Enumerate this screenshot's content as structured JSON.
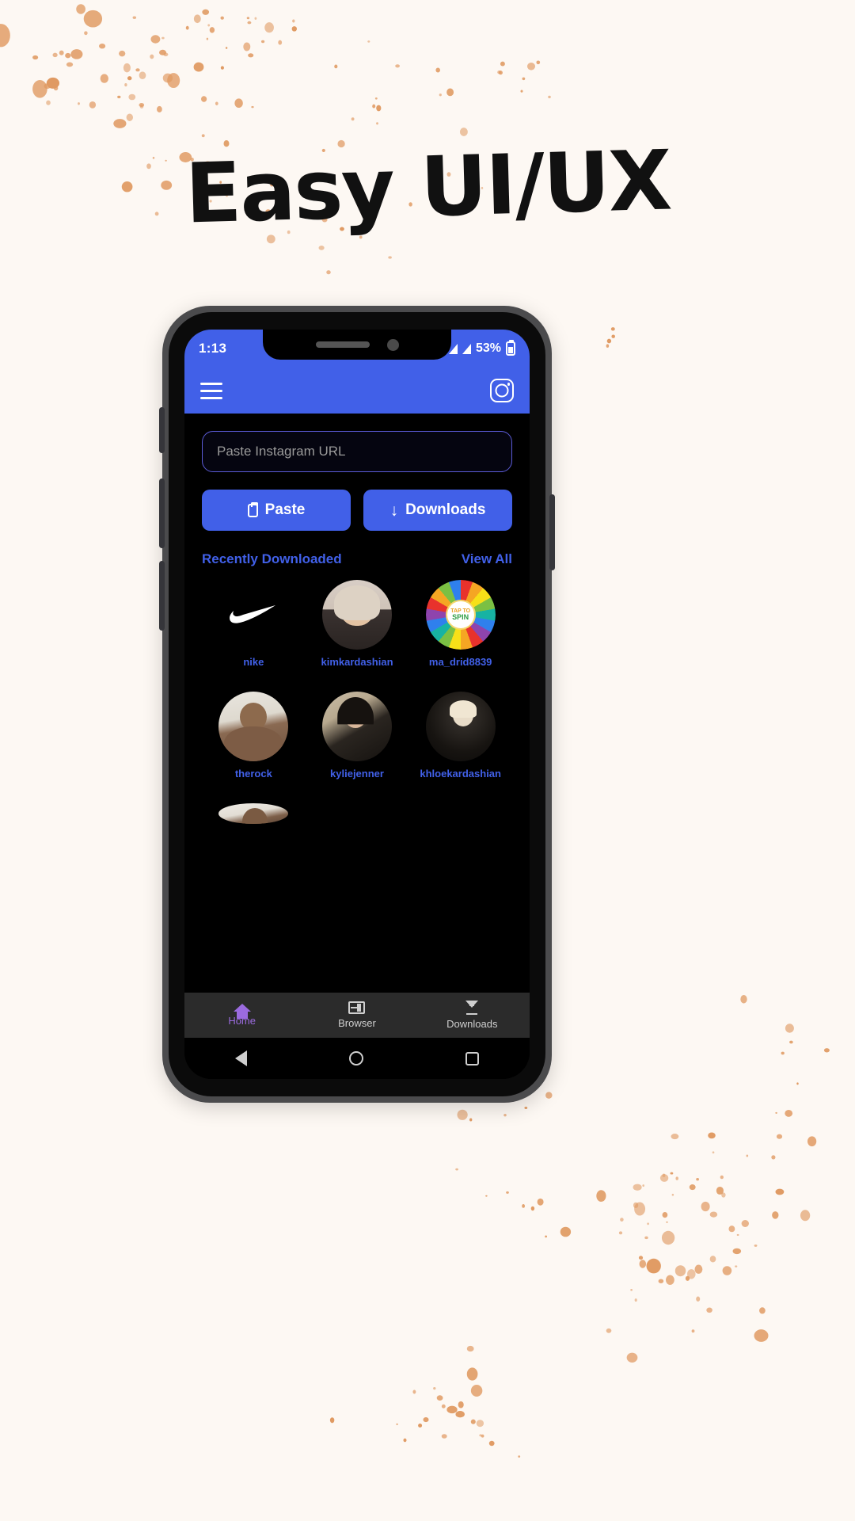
{
  "page": {
    "headline": "Easy UI/UX",
    "background_color": "#FDF8F3",
    "splatter_color": "#E09A62"
  },
  "phone": {
    "frame_color": "#4b4b4d",
    "accent_color": "#4160E8"
  },
  "status_bar": {
    "time": "1:13",
    "battery_percent": "53%",
    "signal_icon": "signal-triangle-icon",
    "battery_icon": "battery-icon"
  },
  "app_bar": {
    "menu_icon": "hamburger-menu-icon",
    "brand_icon": "instagram-icon"
  },
  "url_input": {
    "value": "",
    "placeholder": "Paste Instagram URL"
  },
  "actions": {
    "paste_label": "Paste",
    "paste_icon": "clipboard-icon",
    "downloads_label": "Downloads",
    "downloads_icon": "download-arrow-icon"
  },
  "recent_section": {
    "title": "Recently Downloaded",
    "view_all": "View All",
    "items": [
      {
        "username": "nike",
        "art": "av-nike"
      },
      {
        "username": "kimkardashian",
        "art": "av-kim"
      },
      {
        "username": "ma_drid8839",
        "art": "av-wheel"
      },
      {
        "username": "therock",
        "art": "av-rock"
      },
      {
        "username": "kyliejenner",
        "art": "av-kylie"
      },
      {
        "username": "khloekardashian",
        "art": "av-khloe"
      }
    ],
    "wheel_hub": {
      "line1": "TAP TO",
      "line2": "SPIN"
    }
  },
  "bottom_nav": {
    "items": [
      {
        "label": "Home",
        "icon": "home-icon",
        "active": true
      },
      {
        "label": "Browser",
        "icon": "browser-icon",
        "active": false
      },
      {
        "label": "Downloads",
        "icon": "download-icon",
        "active": false
      }
    ]
  },
  "android_nav": {
    "back_icon": "back-triangle-icon",
    "home_icon": "home-circle-icon",
    "recents_icon": "recents-square-icon"
  }
}
